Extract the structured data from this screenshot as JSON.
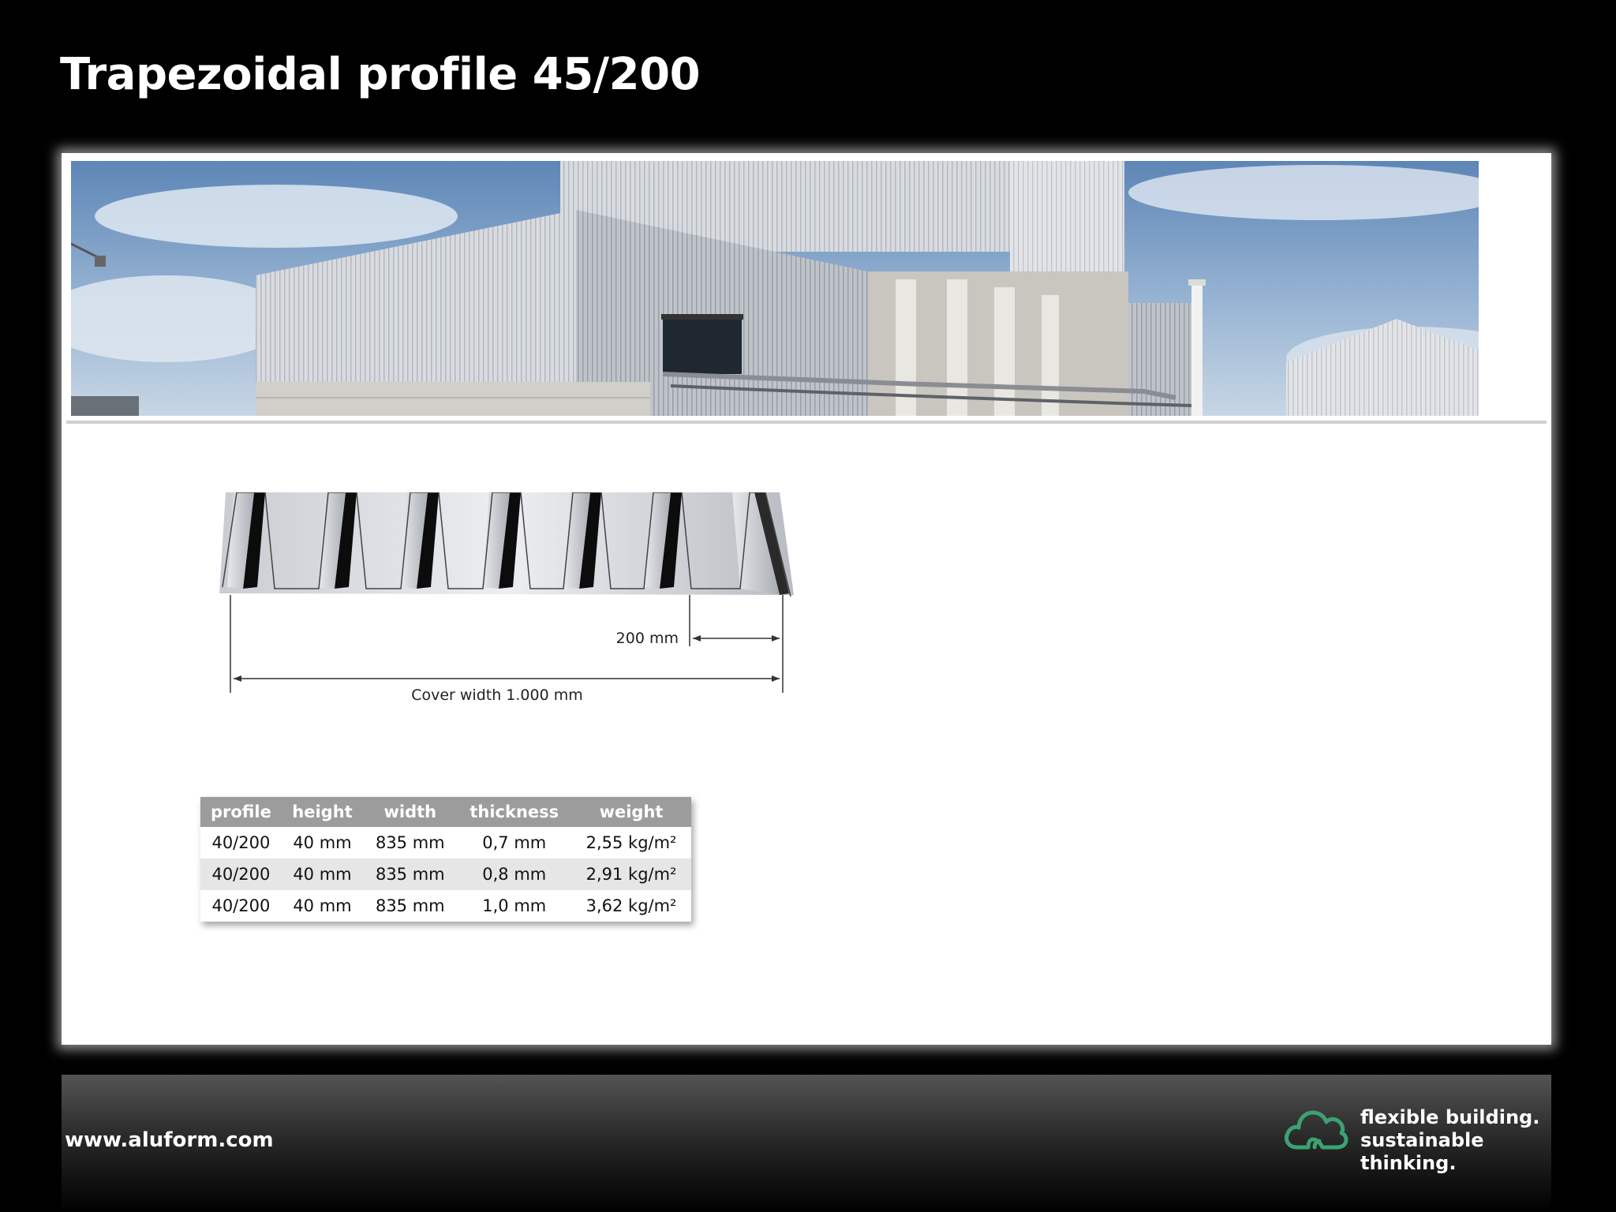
{
  "page": {
    "title": "Trapezoidal profile 45/200"
  },
  "hero": {
    "image": "industrial-building-with-aluminium-cladding"
  },
  "profile_drawing": {
    "rib_label": "200 mm",
    "cover_label": "Cover width 1.000 mm"
  },
  "spec_table": {
    "headers": [
      "profile",
      "height",
      "width",
      "thickness",
      "weight"
    ],
    "rows": [
      [
        "40/200",
        "40 mm",
        "835 mm",
        "0,7 mm",
        "2,55 kg/m²"
      ],
      [
        "40/200",
        "40 mm",
        "835 mm",
        "0,8 mm",
        "2,91 kg/m²"
      ],
      [
        "40/200",
        "40 mm",
        "835 mm",
        "1,0 mm",
        "3,62 kg/m²"
      ]
    ]
  },
  "footer": {
    "website": "www.aluform.com",
    "tagline_line1": "flexible building.",
    "tagline_line2": "sustainable thinking.",
    "logo_icon": "cloud-icon",
    "logo_color": "#3aa371"
  }
}
